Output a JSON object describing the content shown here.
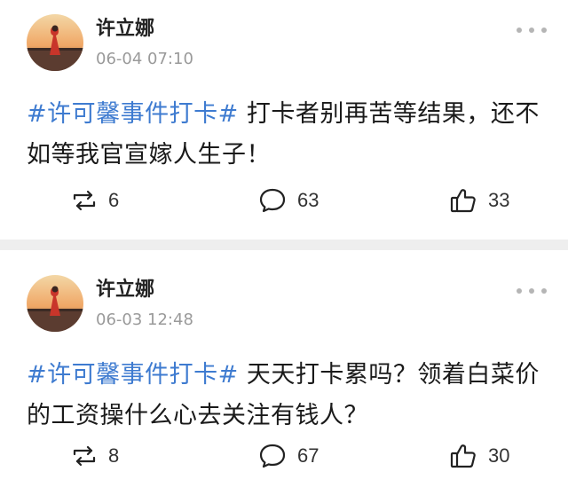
{
  "posts": [
    {
      "user": "许立娜",
      "time": "06-04 07:10",
      "hashtag": "#许可馨事件打卡#",
      "text": " 打卡者别再苦等结果，还不如等我官宣嫁人生子！",
      "reposts": "6",
      "comments": "63",
      "likes": "33"
    },
    {
      "user": "许立娜",
      "time": "06-03 12:48",
      "hashtag": "#许可馨事件打卡#",
      "text": " 天天打卡累吗？领着白菜价的工资操什么心去关注有钱人？",
      "reposts": "8",
      "comments": "67",
      "likes": "30"
    }
  ],
  "icons": {
    "repost": "repost-icon",
    "comment": "comment-icon",
    "like": "thumbs-up-icon",
    "more": "more-dots-icon"
  },
  "colors": {
    "hashtag": "#3e7bd0",
    "timestamp": "#9a9a9a",
    "divider": "#eeeeee"
  }
}
